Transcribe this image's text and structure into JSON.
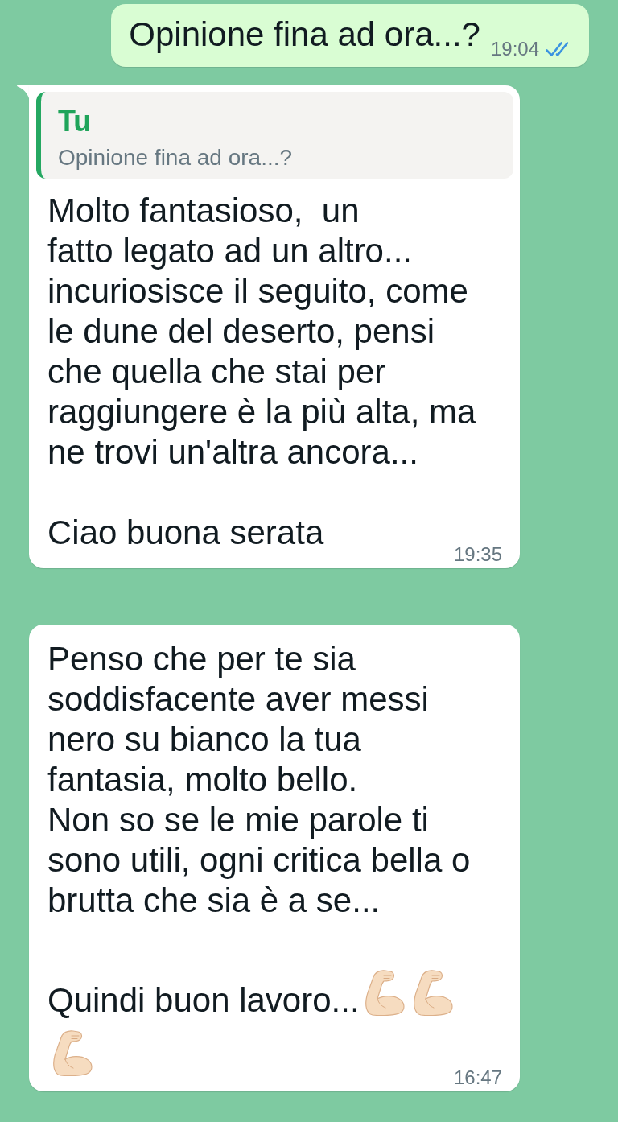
{
  "messages": [
    {
      "kind": "sent",
      "tail": false,
      "text": "Opinione fina ad ora...?",
      "time": "19:04",
      "read": true
    },
    {
      "kind": "received",
      "tail": true,
      "quote": {
        "author": "Tu",
        "text": "Opinione fina ad ora...?"
      },
      "paragraphs": [
        "Molto fantasioso,  un\nfatto legato ad un altro...\nincuriosisce il seguito, come\nle dune del deserto, pensi\nche quella che stai per\nraggiungere è la più alta, ma\nne trovi un'altra ancora...",
        "Ciao buona serata"
      ],
      "time": "19:35"
    },
    {
      "kind": "received",
      "tail": false,
      "paragraphs": [
        "Penso che per te sia\nsoddisfacente aver messi\nnero su bianco la tua\nfantasia, molto bello.\nNon so se le mie parole ti\nsono utili, ogni critica bella o\nbrutta che sia è a se...",
        "Quindi buon lavoro..."
      ],
      "emojis": [
        {
          "kind": "flexed-biceps"
        },
        {
          "kind": "flexed-biceps"
        },
        {
          "kind": "flexed-biceps"
        }
      ],
      "time": "16:47"
    }
  ]
}
